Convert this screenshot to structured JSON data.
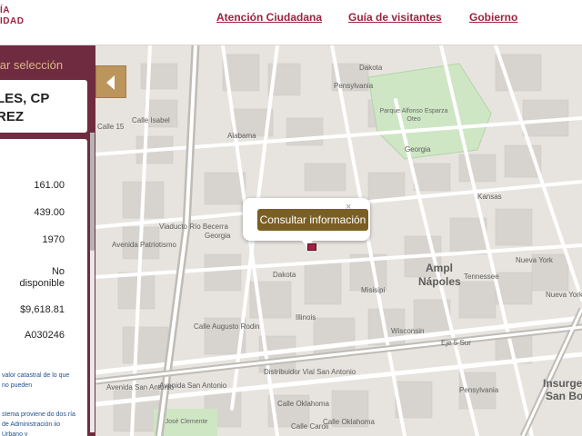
{
  "header": {
    "logo_line1": "ÍA",
    "logo_line2": "IDAD",
    "nav": [
      "Atención Ciudadana",
      "Guía de visitantes",
      "Gobierno"
    ]
  },
  "sidebar": {
    "title": "ultar selección",
    "address_line1": "LES, CP",
    "address_line2": "REZ",
    "values": [
      "161.00",
      "439.00",
      "1970",
      "No\ndisponible",
      "$9,618.81",
      "A030246"
    ],
    "note1": "valor catastral de lo que no pueden",
    "note2": "stema proviene do dos ría de Administración iio Urbano y"
  },
  "map": {
    "popup_button": "Consultar información",
    "popup_close": "×",
    "area_name_1": "Ampl",
    "area_name_2": "Nápoles",
    "area_name_3": "Insurgen",
    "area_name_4": "San Bo",
    "park_name": "Parque Alfonso Esparza Oteo",
    "park2_name": "José Clemente",
    "streets": [
      "Calle Isabel",
      "Pensylvania",
      "Dakota",
      "Alabama",
      "Georgia",
      "Kansas",
      "Dakota",
      "Illinois",
      "Misisipi",
      "Wisconsin",
      "Tennessee",
      "Nueva York",
      "Eje 5 Sur",
      "Distribuidor Vial San Antonio",
      "Avenida San Antonio",
      "Calle Augusto Rodin",
      "Calle Oklahoma",
      "Pensylvania",
      "Calle 15",
      "Avenida Patriotismo",
      "Viaducto Río Becerra",
      "Georgia",
      "Calle Oklahoma",
      "Nueva York",
      "Avenida San Antonio",
      "Calle Caroli"
    ]
  }
}
